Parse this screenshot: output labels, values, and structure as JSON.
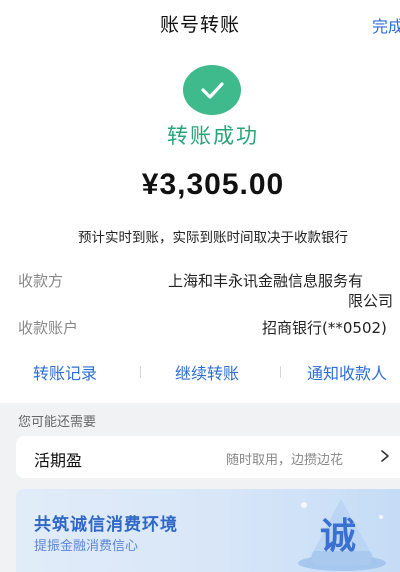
{
  "header": {
    "title": "账号转账",
    "done_label": "完成"
  },
  "result": {
    "status_icon": "check-icon",
    "status_text": "转账成功",
    "amount": "¥3,305.00",
    "note": "预计实时到账，实际到账时间取决于收款银行"
  },
  "details": {
    "payee_label": "收款方",
    "payee_line1": "上海和丰永讯金融信息服务有",
    "payee_line2": "限公司",
    "account_label": "收款账户",
    "account_value": "招商银行(**0502)"
  },
  "actions": {
    "records": "转账记录",
    "continue": "继续转账",
    "notify": "通知收款人"
  },
  "recommend": {
    "section_title": "您可能还需要",
    "product_name": "活期盈",
    "product_desc": "随时取用，边攒边花"
  },
  "banner": {
    "title": "共筑诚信消费环境",
    "subtitle": "提振金融消费信心",
    "art_text": "诚"
  },
  "colors": {
    "accent": "#2c6fd6",
    "success": "#3fba8c",
    "success_text": "#2aa57a"
  }
}
